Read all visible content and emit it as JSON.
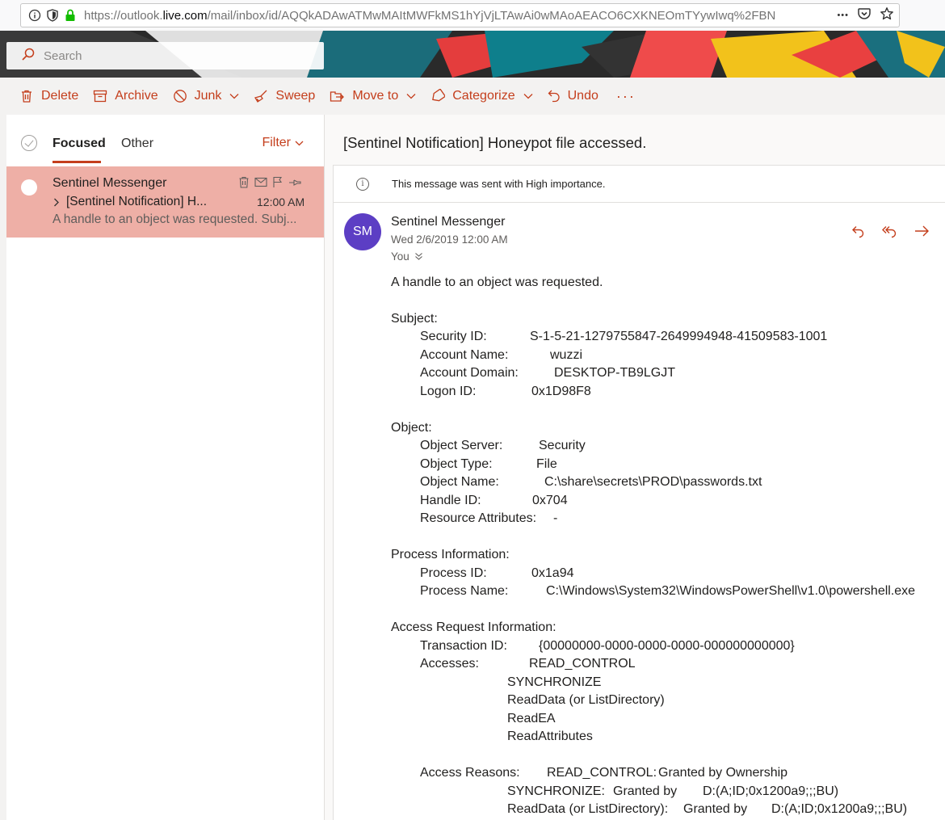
{
  "browser": {
    "url_prefix": "https://outlook.",
    "url_host": "live.com",
    "url_rest": "/mail/inbox/id/AQQkADAwATMwMAItMWFkMS1hYjVjLTAwAi0wMAoAEACO6CXKNEOmTYywIwq%2FBN",
    "more_label": "•••"
  },
  "search": {
    "placeholder": "Search"
  },
  "commands": {
    "delete": "Delete",
    "archive": "Archive",
    "junk": "Junk",
    "sweep": "Sweep",
    "move_to": "Move to",
    "categorize": "Categorize",
    "undo": "Undo",
    "more": "···"
  },
  "list": {
    "tab_focused": "Focused",
    "tab_other": "Other",
    "filter": "Filter",
    "item": {
      "sender": "Sentinel Messenger",
      "subject": "[Sentinel Notification] H...",
      "time": "12:00 AM",
      "preview": "A handle to an object was requested. Subj..."
    }
  },
  "reading": {
    "title": "[Sentinel Notification] Honeypot file accessed.",
    "importance": "This message was sent with High importance.",
    "avatar_initials": "SM",
    "from": "Sentinel Messenger",
    "date": "Wed 2/6/2019 12:00 AM",
    "to": "You"
  },
  "body": {
    "intro": "A handle to an object was requested.",
    "subject_header": "Subject:",
    "security_id_label": "Security ID:",
    "security_id": "S-1-5-21-1279755847-2649994948-41509583-1001",
    "account_name_label": "Account Name:",
    "account_name": "wuzzi",
    "account_domain_label": "Account Domain:",
    "account_domain": "DESKTOP-TB9LGJT",
    "logon_id_label": "Logon ID:",
    "logon_id": "0x1D98F8",
    "object_header": "Object:",
    "object_server_label": "Object Server:",
    "object_server": "Security",
    "object_type_label": "Object Type:",
    "object_type": "File",
    "object_name_label": "Object Name:",
    "object_name": "C:\\share\\secrets\\PROD\\passwords.txt",
    "handle_id_label": "Handle ID:",
    "handle_id": "0x704",
    "resource_attributes_label": "Resource Attributes:",
    "resource_attributes": "-",
    "process_header": "Process Information:",
    "process_id_label": "Process ID:",
    "process_id": "0x1a94",
    "process_name_label": "Process Name:",
    "process_name": "C:\\Windows\\System32\\WindowsPowerShell\\v1.0\\powershell.exe",
    "access_header": "Access Request Information:",
    "transaction_id_label": "Transaction ID:",
    "transaction_id": "{00000000-0000-0000-0000-000000000000}",
    "accesses_label": "Accesses:",
    "accesses": [
      "READ_CONTROL",
      "SYNCHRONIZE",
      "ReadData (or ListDirectory)",
      "ReadEA",
      "ReadAttributes"
    ],
    "access_reasons_label": "Access Reasons:",
    "reason1_right": "READ_CONTROL:",
    "reason1_value": "Granted by Ownership",
    "reason2_right": "SYNCHRONIZE:",
    "reason2_granted": "Granted by",
    "reason2_value": "D:(A;ID;0x1200a9;;;BU)",
    "reason3_right": "ReadData (or ListDirectory):",
    "reason3_granted": "Granted by",
    "reason3_value": "D:(A;ID;0x1200a9;;;BU)"
  },
  "colors": {
    "accent": "#c43e1c",
    "selected_item": "#eeafa6",
    "avatar": "#5c3ec4"
  }
}
